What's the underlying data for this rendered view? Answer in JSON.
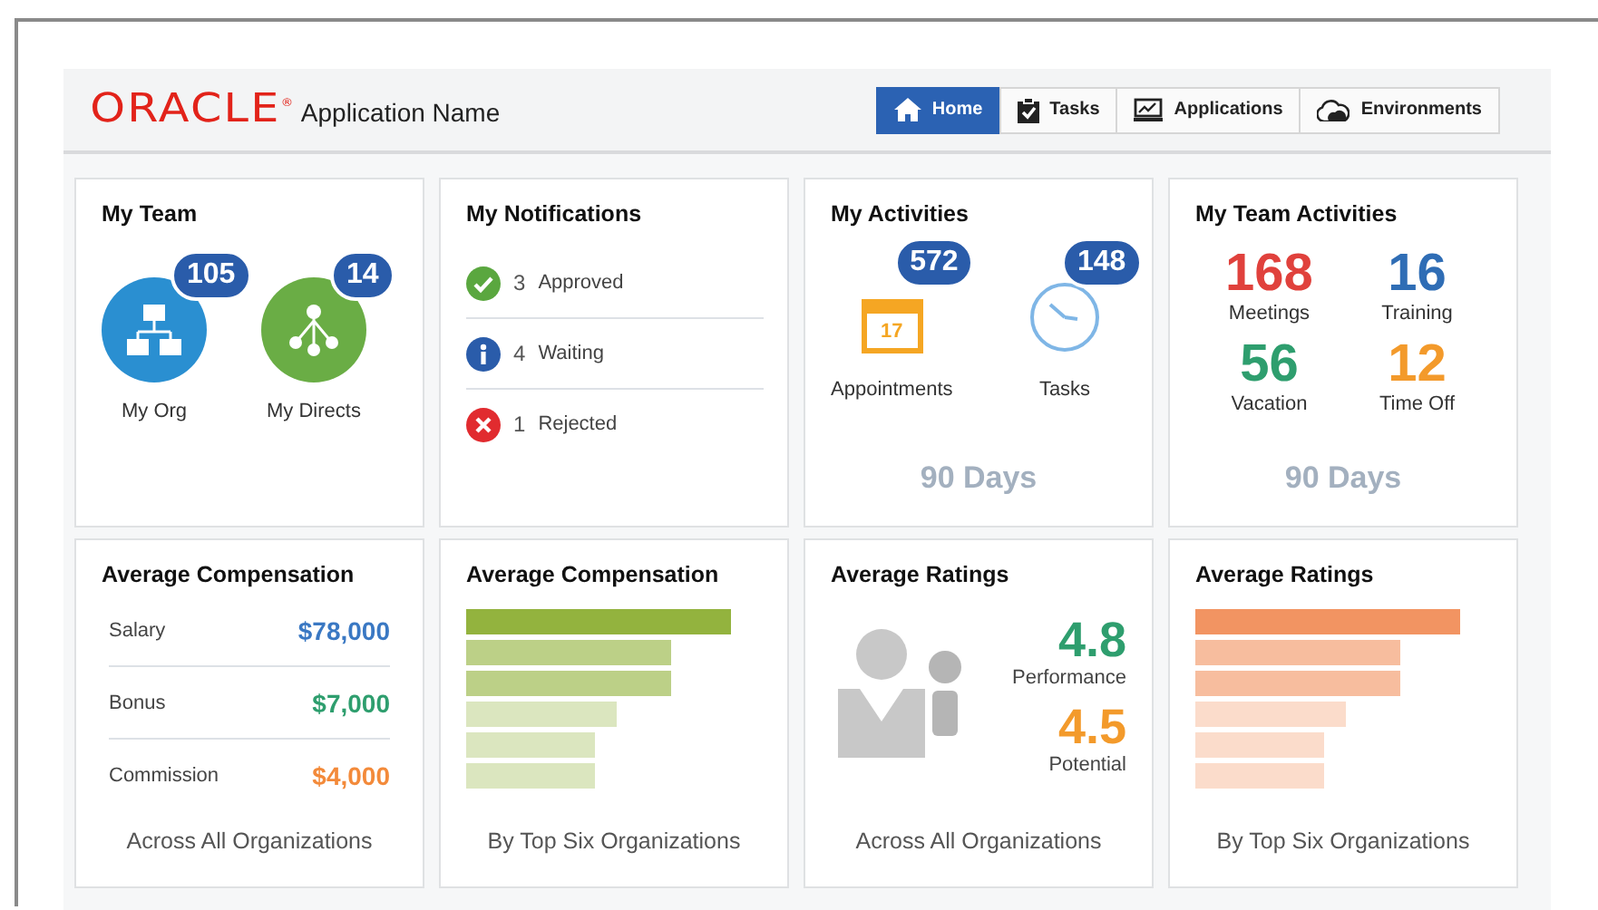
{
  "header": {
    "logo": "ORACLE$^{®}$",
    "app_name": "Application Name",
    "nav": [
      {
        "label": "Home",
        "kind": "home",
        "selected": true
      },
      {
        "label": "Tasks",
        "kind": "clipboard",
        "selected": false
      },
      {
        "label": "Applications",
        "kind": "monitor",
        "selected": false
      },
      {
        "label": "Environments",
        "kind": "cloud",
        "selected": false
      }
    ]
  },
  "cards": [
    {
      "kind": "team",
      "title": "My Team",
      "items": [
        {
          "label": "My Org",
          "count": "105",
          "kind": "org",
          "color": "#2a8fd1"
        },
        {
          "label": "My Directs",
          "count": "14",
          "kind": "tree",
          "color": "#6aad45"
        }
      ]
    },
    {
      "kind": "notifications",
      "title": "My Notifications",
      "items": [
        {
          "kind": "approved",
          "count": "3",
          "label": "Approved"
        },
        {
          "kind": "info",
          "count": "4",
          "label": "Waiting"
        },
        {
          "kind": "rejected",
          "count": "1",
          "label": "Rejected"
        }
      ]
    },
    {
      "kind": "activities",
      "title": "My Activities",
      "items": [
        {
          "kind": "calendar",
          "icon_text": "17",
          "count": "572",
          "label": "Appointments"
        },
        {
          "kind": "clock",
          "count": "148",
          "label": "Tasks"
        }
      ],
      "footer": "90 Days"
    },
    {
      "kind": "stats",
      "title": "My Team Activities",
      "items": [
        {
          "value": "168",
          "label": "Meetings",
          "color": "#e0413c"
        },
        {
          "value": "16",
          "label": "Training",
          "color": "#2f6db5"
        },
        {
          "value": "56",
          "label": "Vacation",
          "color": "#2e9e6e"
        },
        {
          "value": "12",
          "label": "Time Off",
          "color": "#f39a2b"
        }
      ],
      "footer": "90 Days"
    },
    {
      "kind": "list",
      "title": "Average Compensation",
      "items": [
        {
          "label": "Salary",
          "value": "$78,000",
          "color": "#3a78c3"
        },
        {
          "label": "Bonus",
          "value": "$7,000",
          "color": "#2e9e6e"
        },
        {
          "label": "Commission",
          "value": "$4,000",
          "color": "#f38a3a"
        }
      ],
      "footer": "Across All Organizations"
    },
    {
      "kind": "bars",
      "title": "Average Compensation",
      "color": "#93b33e",
      "footer": "By Top Six Organizations"
    },
    {
      "kind": "ratings",
      "title": "Average Ratings",
      "items": [
        {
          "value": "4.8",
          "label": "Performance",
          "color": "#2e9e6e"
        },
        {
          "value": "4.5",
          "label": "Potential",
          "color": "#f39a2b"
        }
      ],
      "footer": "Across All Organizations"
    },
    {
      "kind": "bars",
      "title": "Average Ratings",
      "color": "#f29462",
      "footer": "By Top Six Organizations"
    }
  ]
}
